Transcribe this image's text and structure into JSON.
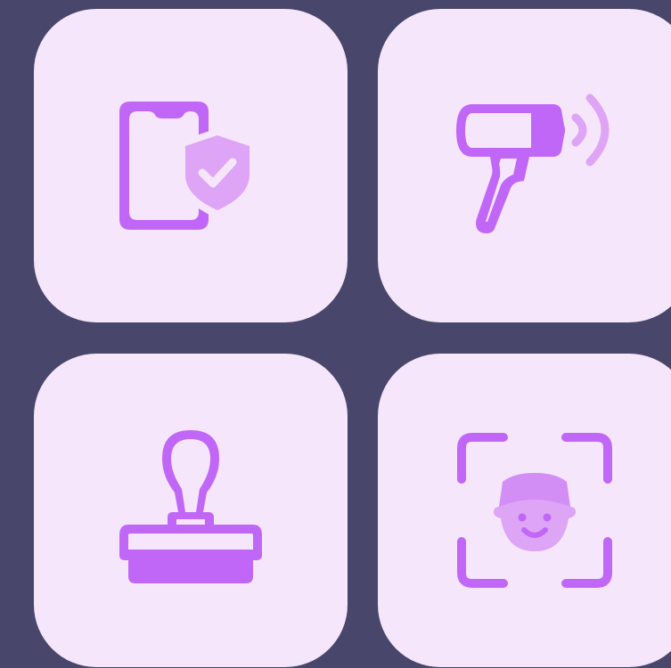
{
  "colors": {
    "background": "#48466a",
    "tile": "#f5e6fc",
    "icon_primary": "#c067f7",
    "icon_secondary": "#dea4f6"
  },
  "tiles": [
    {
      "icon": "phone-shield-check-icon"
    },
    {
      "icon": "barcode-scanner-icon"
    },
    {
      "icon": "rubber-stamp-icon"
    },
    {
      "icon": "face-scan-icon"
    }
  ]
}
